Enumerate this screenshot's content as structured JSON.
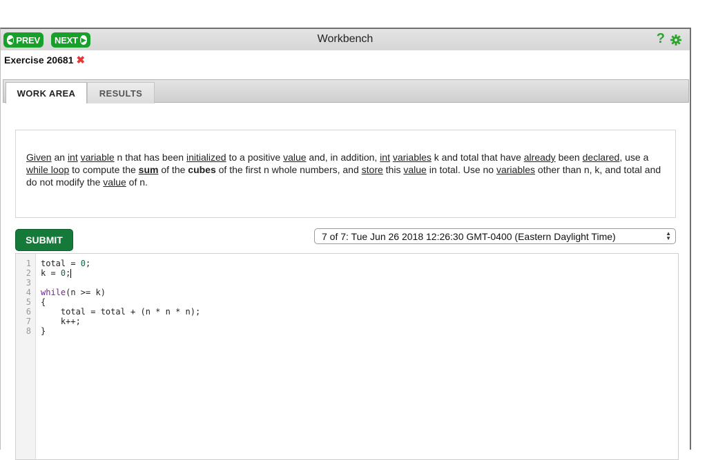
{
  "toolbar": {
    "prev_label": "PREV",
    "next_label": "NEXT",
    "title": "Workbench",
    "help_label": "?"
  },
  "exercise": {
    "label": "Exercise 20681"
  },
  "tabs": [
    {
      "label": "WORK AREA",
      "active": true
    },
    {
      "label": "RESULTS",
      "active": false
    }
  ],
  "problem": {
    "segments": [
      "Given",
      " an ",
      "int",
      " ",
      "variable",
      " n that has been ",
      "initialized",
      " to a positive ",
      "value",
      " and, in addition, ",
      "int",
      " ",
      "variables",
      " k and total that have ",
      "already",
      " been ",
      "declared",
      ", use a ",
      "while loop",
      " to compute the ",
      "sum",
      " of the ",
      "cubes",
      " of the first n whole numbers, and ",
      "store",
      " this ",
      "value",
      " in total. Use no ",
      "variables",
      " other than n, k, and total and do not modify the ",
      "value",
      " of n."
    ]
  },
  "submit": {
    "label": "SUBMIT"
  },
  "submission_select": {
    "value": "7 of 7: Tue Jun 26 2018 12:26:30 GMT-0400 (Eastern Daylight Time)"
  },
  "editor": {
    "line_numbers": [
      "1",
      "2",
      "3",
      "4",
      "5",
      "6",
      "7",
      "8"
    ],
    "lines": [
      "total = 0;",
      "k = 0;",
      "",
      "while(n >= k)",
      "{",
      "    total = total + (n * n * n);",
      "    k++;",
      "}"
    ]
  },
  "colors": {
    "nav_green": "#18a02a",
    "submit_green": "#15793a",
    "error_red": "#e03a3a",
    "keyword_purple": "#7a1fa2"
  }
}
